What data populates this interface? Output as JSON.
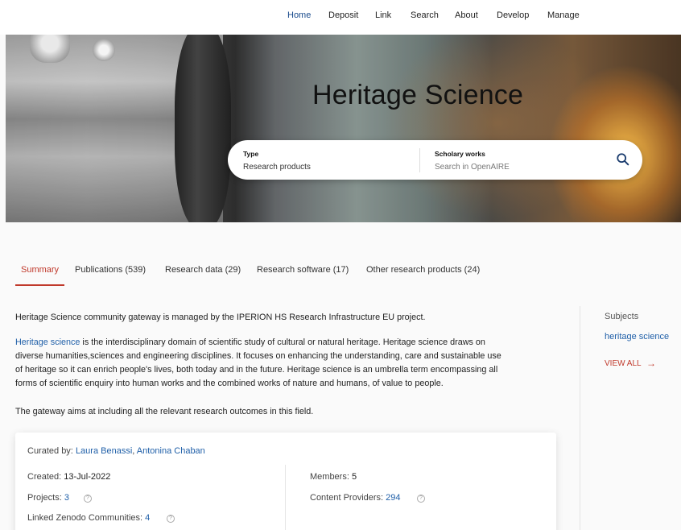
{
  "nav": {
    "items": [
      "Home",
      "Deposit",
      "Link",
      "Search",
      "About",
      "Develop",
      "Manage"
    ],
    "active": "Home"
  },
  "hero": {
    "title": "Heritage Science"
  },
  "search": {
    "type_label": "Type",
    "type_value": "Research products",
    "scope_label": "Scholary works",
    "scope_placeholder": "Search in OpenAIRE",
    "icon": "search-icon"
  },
  "tabs": [
    {
      "label": "Summary"
    },
    {
      "label": "Publications (539)"
    },
    {
      "label": "Research data (29)"
    },
    {
      "label": "Research software (17)"
    },
    {
      "label": "Other research products (24)"
    }
  ],
  "summary": {
    "intro": "Heritage Science community gateway is managed by the IPERION HS Research Infrastructure EU project.",
    "link_text": "Heritage science",
    "line1_rest": " is the interdisciplinary domain of scientific study of cultural or natural heritage. Heritage science draws on",
    "line2": "diverse humanities,sciences and engineering disciplines. It focuses on enhancing the understanding, care and sustainable use",
    "line3": "of heritage so it can enrich people's lives, both today and in the future. Heritage science is an umbrella term encompassing all",
    "line4": "forms of scientific enquiry into human works and the combined works of nature and humans, of value to people.",
    "aim": "The gateway aims at including all the relevant research outcomes in this field."
  },
  "sidebar": {
    "title": "Subjects",
    "subject": "heritage science",
    "view_all": "VIEW ALL"
  },
  "card": {
    "curated_label": "Curated by:",
    "curator1": "Laura Benassi",
    "separator": ",",
    "curator2": "Antonina Chaban",
    "created_label": "Created:",
    "created_value": "13-Jul-2022",
    "members_label": "Members:",
    "members_value": "5",
    "projects_label": "Projects:",
    "projects_value": "3",
    "providers_label": "Content Providers:",
    "providers_value": "294",
    "zenodo_label": "Linked Zenodo Communities:",
    "zenodo_value": "4",
    "info_glyph": "?"
  },
  "colors": {
    "accent_red": "#c0392b",
    "link_blue": "#1f5fa8",
    "nav_active": "#1a4b8c"
  }
}
